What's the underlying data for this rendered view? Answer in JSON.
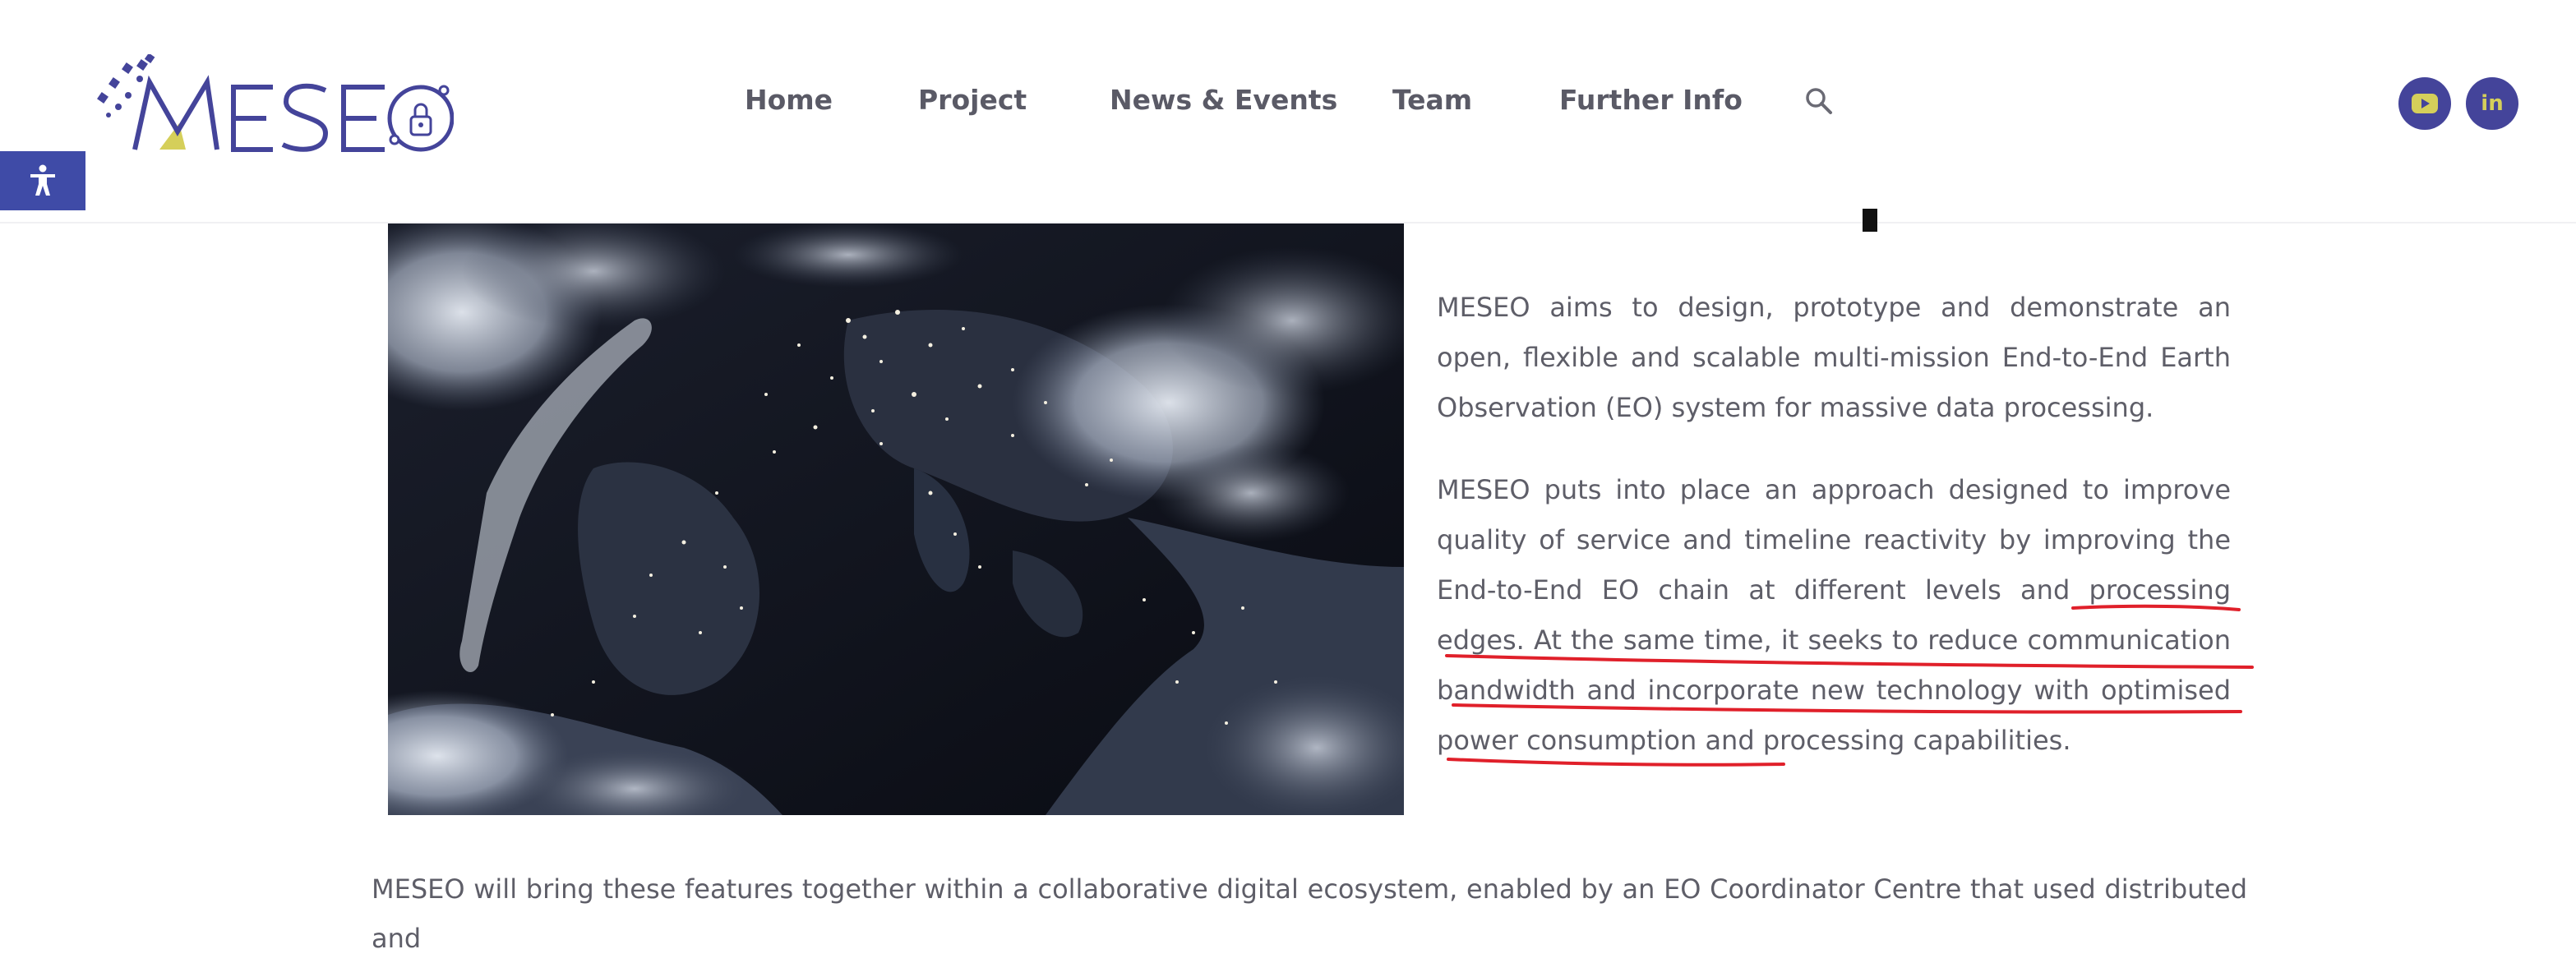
{
  "header": {
    "logo_text": "MESEO",
    "nav": [
      {
        "label": "Home"
      },
      {
        "label": "Project"
      },
      {
        "label": "News & Events"
      },
      {
        "label": "Team"
      },
      {
        "label": "Further Info"
      }
    ],
    "search_icon": "search-icon",
    "social": [
      {
        "icon": "youtube-icon"
      },
      {
        "icon": "linkedin-icon",
        "text": "in"
      }
    ]
  },
  "accessibility": {
    "icon": "accessibility-icon"
  },
  "content": {
    "image_alt": "Satellite view of Europe at night",
    "paragraph1": "MESEO aims to design, prototype and demonstrate an open, flexible and scalable multi-mission End-to-End Earth Observation (EO) system for massive data processing.",
    "paragraph2": "MESEO puts into place an approach designed to improve quality of service and timeline reactivity by improving the End-to-End EO chain at different levels and processing edges. At the same time, it seeks to reduce communication bandwidth and incorporate new technology with optimised power consumption and processing capabilities.",
    "paragraph3": "MESEO will bring these features together within a collaborative digital ecosystem, enabled by an EO Coordinator Centre that used distributed and"
  },
  "colors": {
    "brand": "#44449a",
    "brand_accent": "#d5cf5a",
    "annotation": "#e0202a",
    "text": "#5e5e68"
  }
}
